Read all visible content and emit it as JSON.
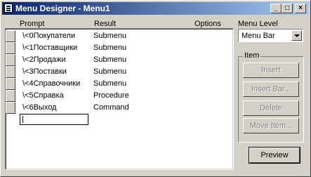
{
  "window": {
    "title": "Menu Designer - Menu1"
  },
  "titlebar_buttons": {
    "minimize": "_",
    "maximize": "□",
    "close": "×"
  },
  "headers": {
    "prompt": "Prompt",
    "result": "Result",
    "options": "Options",
    "menu_level": "Menu Level"
  },
  "rows": [
    {
      "prompt": "\\<0Покупатели",
      "result": "Submenu"
    },
    {
      "prompt": "\\<1Поставщики",
      "result": "Submenu"
    },
    {
      "prompt": "\\<2Продажи",
      "result": "Submenu"
    },
    {
      "prompt": "\\<3Поставки",
      "result": "Submenu"
    },
    {
      "prompt": "\\<4Справочники",
      "result": "Submenu"
    },
    {
      "prompt": "\\<5Справка",
      "result": "Procedure"
    },
    {
      "prompt": "\\<6Выход",
      "result": "Command"
    }
  ],
  "menu_level": {
    "value": "Menu Bar"
  },
  "item_group": {
    "title": "Item",
    "buttons": [
      "Insert",
      "Insert Bar...",
      "Delete",
      "Move Item..."
    ]
  },
  "preview_button": "Preview"
}
